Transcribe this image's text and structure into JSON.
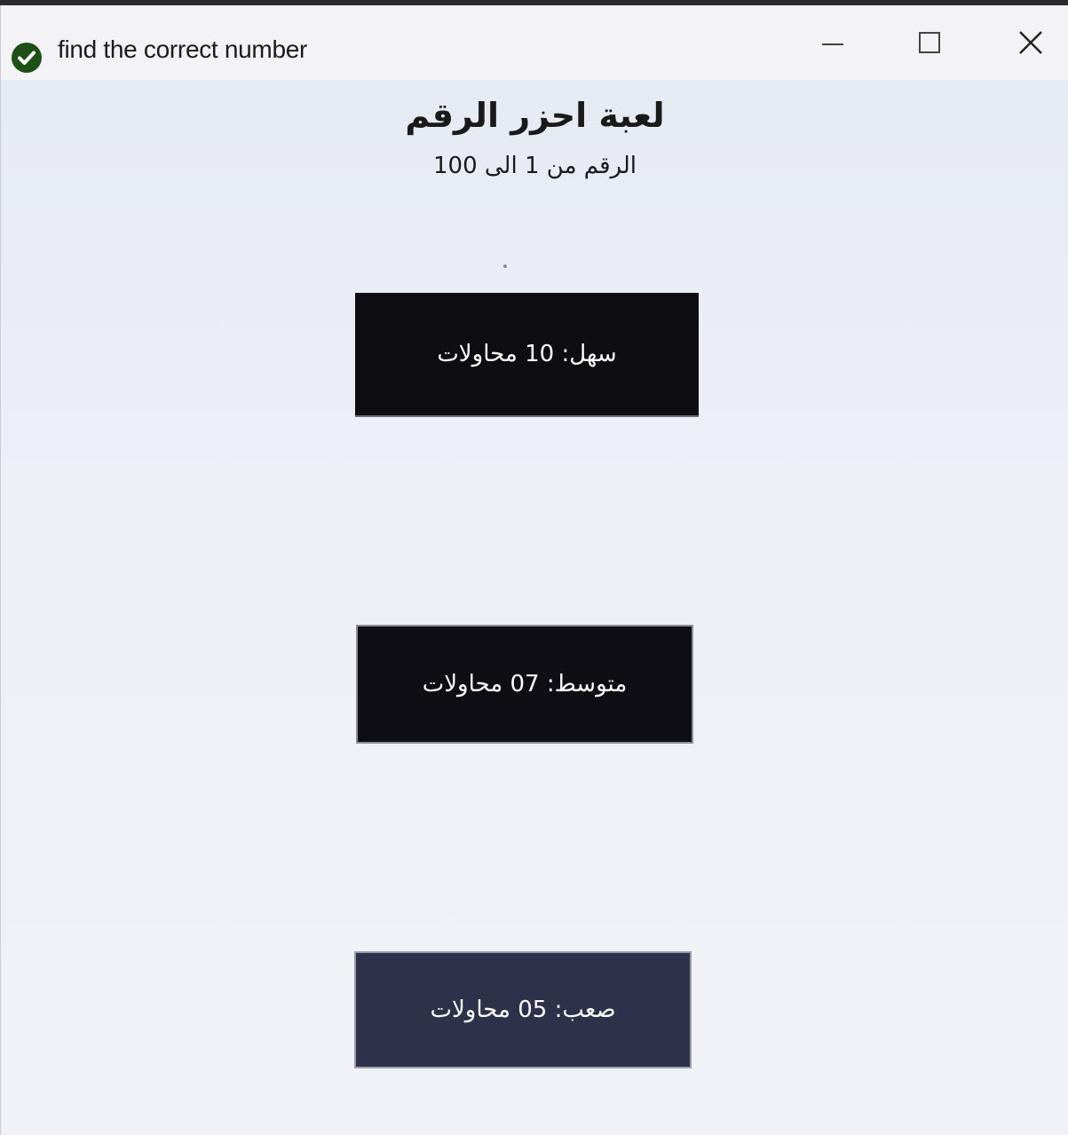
{
  "window": {
    "title": "find the correct number",
    "controls": {
      "minimize_icon": "minimize-icon",
      "maximize_icon": "maximize-icon",
      "close_icon": "close-icon"
    }
  },
  "game": {
    "title": "لعبة احزر الرقم",
    "subtitle": "الرقم من 1 الى 100",
    "buttons": {
      "easy": "سهل: 10 محاولات",
      "medium": "متوسط: 07 محاولات",
      "hard": "صعب: 05 محاولات"
    }
  },
  "colors": {
    "app_icon": "#1d4f17",
    "easy_button": "#0e0d12",
    "medium_button": "#0f0e14",
    "hard_button": "#2d3149"
  }
}
